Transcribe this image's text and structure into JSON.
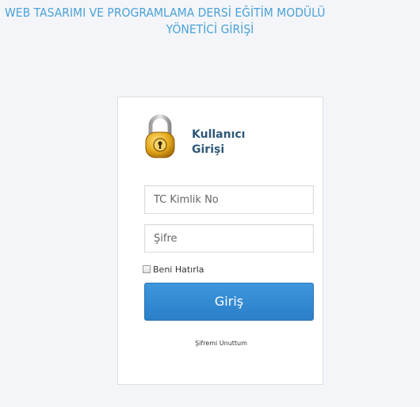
{
  "header": {
    "title_line1": "WEB TASARIMI VE PROGRAMLAMA DERSİ EĞİTİM MODÜLÜ",
    "title_line2": "YÖNETİCİ GİRİŞİ"
  },
  "login": {
    "heading_line1": "Kullanıcı",
    "heading_line2": "Girişi",
    "tc_placeholder": "TC Kimlik No",
    "tc_value": "",
    "password_placeholder": "Şifre",
    "password_value": "",
    "remember_label": "Beni Hatırla",
    "remember_checked": false,
    "submit_label": "Giriş",
    "forgot_label": "Şifremi Unuttum"
  },
  "icons": {
    "lock": "padlock-icon"
  },
  "colors": {
    "title": "#4aa2d8",
    "heading": "#2f5877",
    "button": "#2f86cf",
    "background": "#f4f5f8"
  }
}
